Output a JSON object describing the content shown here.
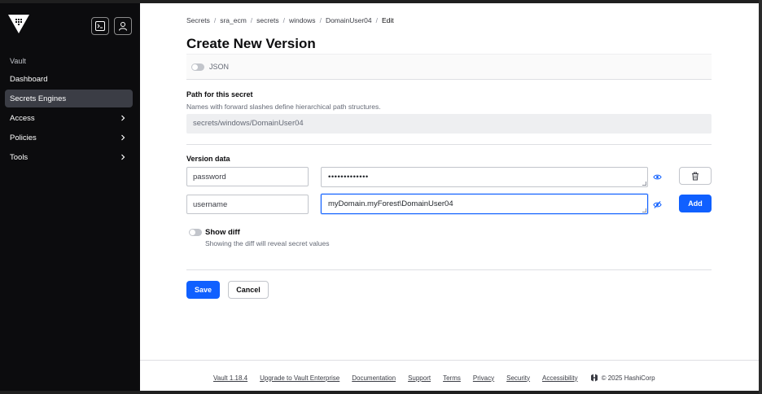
{
  "sidebar": {
    "section_label": "Vault",
    "items": [
      {
        "label": "Dashboard",
        "has_chevron": false,
        "active": false
      },
      {
        "label": "Secrets Engines",
        "has_chevron": false,
        "active": true
      },
      {
        "label": "Access",
        "has_chevron": true,
        "active": false
      },
      {
        "label": "Policies",
        "has_chevron": true,
        "active": false
      },
      {
        "label": "Tools",
        "has_chevron": true,
        "active": false
      }
    ],
    "icons": {
      "logo": "vault-logo-icon",
      "console": "terminal-icon",
      "user": "user-icon"
    }
  },
  "breadcrumb": [
    {
      "label": "Secrets"
    },
    {
      "label": "sra_ecm"
    },
    {
      "label": "secrets"
    },
    {
      "label": "windows"
    },
    {
      "label": "DomainUser04"
    },
    {
      "label": "Edit",
      "current": true
    }
  ],
  "page": {
    "title": "Create New Version",
    "json_toggle_label": "JSON",
    "path_label": "Path for this secret",
    "path_help": "Names with forward slashes define hierarchical path structures.",
    "path_value": "secrets/windows/DomainUser04",
    "version_data_label": "Version data",
    "rows": [
      {
        "key": "password",
        "value": "•••••••••••••",
        "masked": true,
        "action": "delete"
      },
      {
        "key": "username",
        "value": "myDomain.myForest\\DomainUser04",
        "masked": false,
        "action": "add"
      }
    ],
    "add_label": "Add",
    "show_diff_label": "Show diff",
    "show_diff_help": "Showing the diff will reveal secret values",
    "save_label": "Save",
    "cancel_label": "Cancel"
  },
  "footer": {
    "links": [
      "Vault 1.18.4",
      "Upgrade to Vault Enterprise",
      "Documentation",
      "Support",
      "Terms",
      "Privacy",
      "Security",
      "Accessibility"
    ],
    "copyright": "© 2025 HashiCorp"
  },
  "colors": {
    "primary": "#1060ff",
    "sidebar_bg": "#0c0c0e",
    "sidebar_active": "#3b3d45"
  }
}
